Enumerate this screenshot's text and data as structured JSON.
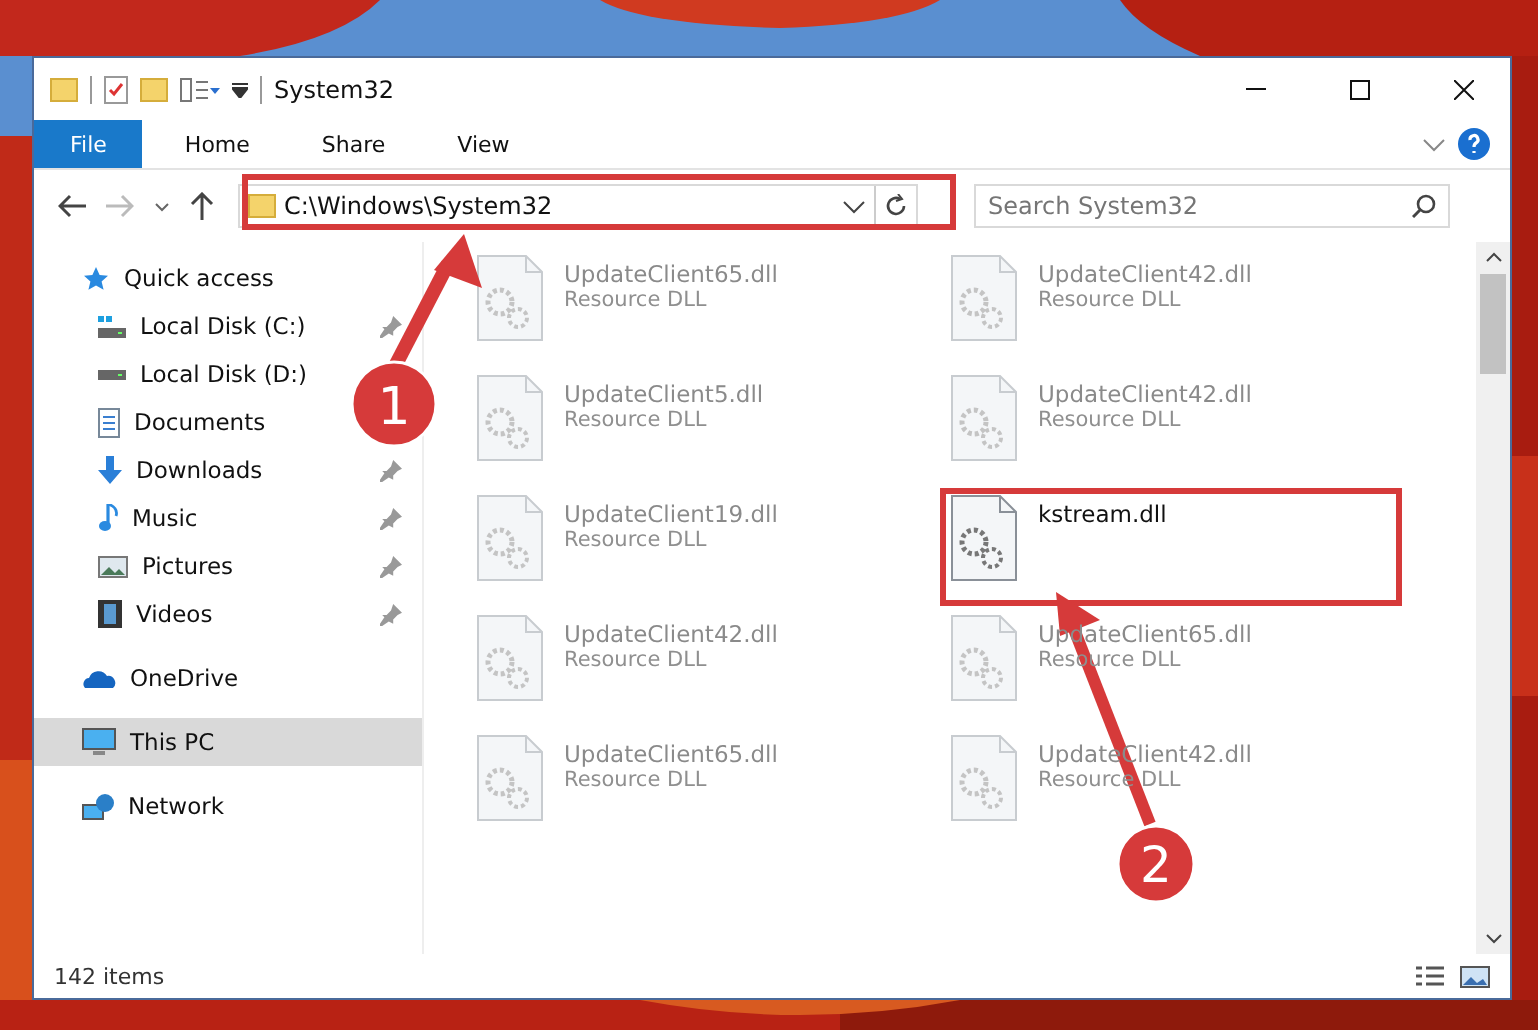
{
  "window": {
    "title": "System32"
  },
  "ribbon_tabs": [
    {
      "label": "File",
      "selected": true
    },
    {
      "label": "Home",
      "selected": false
    },
    {
      "label": "Share",
      "selected": false
    },
    {
      "label": "View",
      "selected": false
    }
  ],
  "address": {
    "path": "C:\\Windows\\System32"
  },
  "search": {
    "placeholder": "Search System32"
  },
  "sidebar": {
    "items": [
      {
        "label": "Quick access",
        "kind": "star",
        "pinned": false,
        "selected": false
      },
      {
        "label": "Local Disk (C:)",
        "kind": "system-drive",
        "pinned": true,
        "selected": false
      },
      {
        "label": "Local Disk (D:)",
        "kind": "drive",
        "pinned": false,
        "selected": false
      },
      {
        "label": "Documents",
        "kind": "documents",
        "pinned": false,
        "selected": false
      },
      {
        "label": "Downloads",
        "kind": "downloads",
        "pinned": true,
        "selected": false
      },
      {
        "label": "Music",
        "kind": "music",
        "pinned": true,
        "selected": false
      },
      {
        "label": "Pictures",
        "kind": "pictures",
        "pinned": true,
        "selected": false
      },
      {
        "label": "Videos",
        "kind": "videos",
        "pinned": true,
        "selected": false
      },
      {
        "label": "OneDrive",
        "kind": "cloud",
        "pinned": false,
        "selected": false
      },
      {
        "label": "This PC",
        "kind": "computer",
        "pinned": false,
        "selected": true
      },
      {
        "label": "Network",
        "kind": "network",
        "pinned": false,
        "selected": false
      }
    ]
  },
  "files": [
    {
      "name": "UpdateClient65.dll",
      "type": "Resource DLL",
      "faded": true
    },
    {
      "name": "UpdateClient42.dll",
      "type": "Resource DLL",
      "faded": true
    },
    {
      "name": "UpdateClient5.dll",
      "type": "Resource DLL",
      "faded": true
    },
    {
      "name": "UpdateClient42.dll",
      "type": "Resource DLL",
      "faded": true
    },
    {
      "name": "UpdateClient19.dll",
      "type": "Resource DLL",
      "faded": true
    },
    {
      "name": "kstream.dll",
      "faded": false
    },
    {
      "name": "UpdateClient42.dll",
      "type": "Resource DLL",
      "faded": true
    },
    {
      "name": "UpdateClient65.dll",
      "type": "Resource DLL",
      "faded": true
    },
    {
      "name": "UpdateClient65.dll",
      "type": "Resource DLL",
      "faded": true
    },
    {
      "name": "UpdateClient42.dll",
      "type": "Resource DLL",
      "faded": true
    }
  ],
  "annotations": [
    {
      "number": "1"
    },
    {
      "number": "2"
    }
  ],
  "status_bar": {
    "count": "142 items"
  }
}
